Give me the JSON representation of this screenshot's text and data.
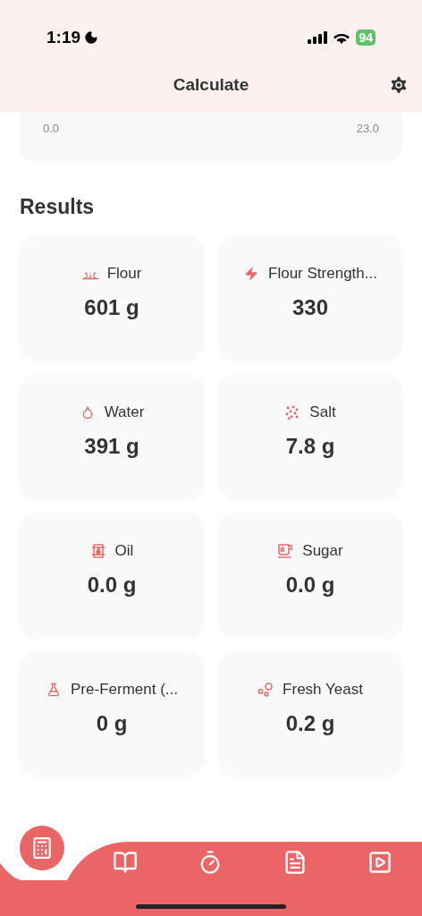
{
  "status_bar": {
    "time": "1:19",
    "battery": "94"
  },
  "header": {
    "title": "Calculate"
  },
  "range_card": {
    "min_label": "0.0",
    "max_label": "23.0"
  },
  "results": {
    "title": "Results",
    "items": [
      {
        "label": "Flour",
        "value": "601 g"
      },
      {
        "label": "Flour Strength...",
        "value": "330"
      },
      {
        "label": "Water",
        "value": "391 g"
      },
      {
        "label": "Salt",
        "value": "7.8 g"
      },
      {
        "label": "Oil",
        "value": "0.0 g"
      },
      {
        "label": "Sugar",
        "value": "0.0 g"
      },
      {
        "label": "Pre-Ferment (...",
        "value": "0 g"
      },
      {
        "label": "Fresh Yeast",
        "value": "0.2 g"
      }
    ]
  },
  "tab_bar": [
    {
      "selected": true
    },
    {
      "selected": false
    },
    {
      "selected": false
    },
    {
      "selected": false
    },
    {
      "selected": false
    }
  ]
}
